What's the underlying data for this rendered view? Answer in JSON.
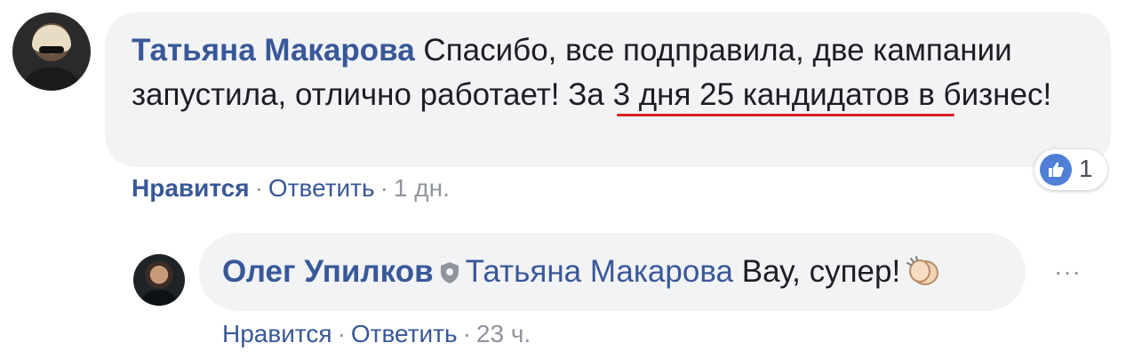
{
  "comment1": {
    "author": "Татьяна Макарова",
    "text_part1": " Спасибо, все подправила, две кампании запустила, отлично работает! ",
    "text_highlight": "За 3 дня 25 кандидатов",
    "text_part2": " в бизнес!",
    "actions": {
      "like": "Нравится",
      "reply": "Ответить",
      "time": "1 дн."
    },
    "reactions": {
      "icon": "thumbs-up-icon",
      "count": "1"
    }
  },
  "comment2": {
    "author": "Олег Упилков",
    "mention": "Татьяна Макарова",
    "text": " Вау, супер!",
    "emoji": "clapping-hands-icon",
    "actions": {
      "like": "Нравится",
      "reply": "Ответить",
      "time": "23 ч."
    },
    "more": "···"
  },
  "colors": {
    "link": "#385898",
    "bubble": "#f2f3f5",
    "highlight_underline": "#e02020",
    "like_icon": "#4f7fd6"
  }
}
